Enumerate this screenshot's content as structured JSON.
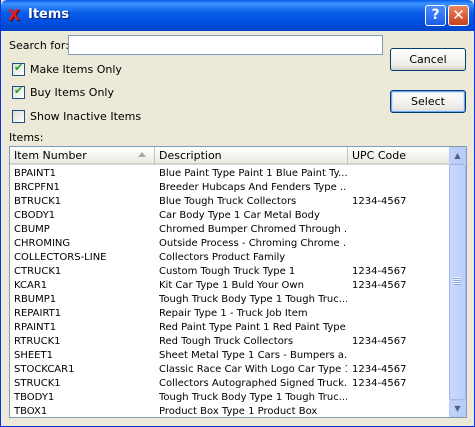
{
  "window": {
    "title": "Items",
    "help_label": "?",
    "close_label": "✕",
    "app_icon": "x-logo-icon"
  },
  "search": {
    "label": "Search for:",
    "value": "",
    "placeholder": ""
  },
  "checkboxes": [
    {
      "label": "Make Items Only",
      "checked": true
    },
    {
      "label": "Buy Items Only",
      "checked": true
    },
    {
      "label": "Show Inactive Items",
      "checked": false
    }
  ],
  "buttons": {
    "cancel": "Cancel",
    "select": "Select"
  },
  "items_label": "Items:",
  "table": {
    "columns": [
      "Item Number",
      "Description",
      "UPC Code"
    ],
    "sort_column": "Item Number",
    "rows": [
      [
        "BPAINT1",
        "Blue Paint Type Paint 1 Blue Paint Ty...",
        ""
      ],
      [
        "BRCPFN1",
        "Breeder Hubcaps And Fenders Type ...",
        ""
      ],
      [
        "BTRUCK1",
        "Blue Tough Truck Collectors",
        "1234-4567"
      ],
      [
        "CBODY1",
        "Car Body Type 1 Car Metal Body",
        ""
      ],
      [
        "CBUMP",
        "Chromed Bumper Chromed Through ...",
        ""
      ],
      [
        "CHROMING",
        "Outside Process - Chroming Chrome ...",
        ""
      ],
      [
        "COLLECTORS-LINE",
        "Collectors Product Family",
        ""
      ],
      [
        "CTRUCK1",
        "Custom Tough Truck Type 1",
        "1234-4567"
      ],
      [
        "KCAR1",
        "Kit Car Type 1 Buld Your Own",
        "1234-4567"
      ],
      [
        "RBUMP1",
        "Tough Truck Body Type 1 Tough Truc...",
        ""
      ],
      [
        "REPAIRT1",
        "Repair Type 1 - Truck  Job Item",
        ""
      ],
      [
        "RPAINT1",
        "Red Paint Type Paint 1 Red Paint Type...",
        ""
      ],
      [
        "RTRUCK1",
        "Red Tough Truck Collectors",
        "1234-4567"
      ],
      [
        "SHEET1",
        "Sheet Metal Type 1 Cars - Bumpers a...",
        ""
      ],
      [
        "STOCKCAR1",
        "Classic Race Car With Logo Car Type 1",
        "1234-4567"
      ],
      [
        "STRUCK1",
        "Collectors Autographed Signed Truck...",
        "1234-4567"
      ],
      [
        "TBODY1",
        "Tough Truck Body Type 1 Tough Truc...",
        ""
      ],
      [
        "TBOX1",
        "Product Box Type 1 Product Box",
        ""
      ]
    ]
  },
  "scrollbar": {
    "up_icon": "arrow-up-icon",
    "down_icon": "arrow-down-icon"
  },
  "colors": {
    "titlebar": "#0054e3",
    "check": "#21a121",
    "close": "#d0502a"
  }
}
